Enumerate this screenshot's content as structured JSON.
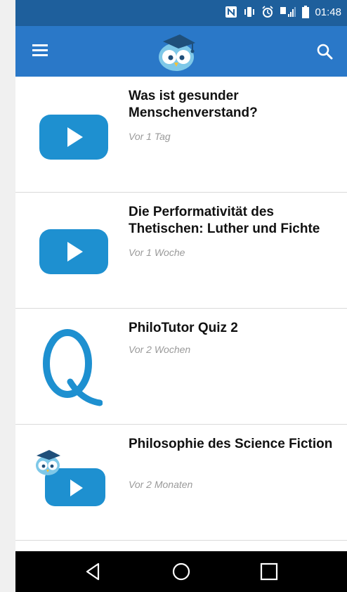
{
  "status_bar": {
    "time": "01:48",
    "icons": [
      "nfc-icon",
      "vibrate-icon",
      "alarm-icon",
      "signal-icon",
      "battery-icon"
    ]
  },
  "app_bar": {
    "menu_icon": "hamburger-menu-icon",
    "logo": "owl-logo",
    "search_icon": "search-icon",
    "color": "#2a78c8"
  },
  "feed": {
    "items": [
      {
        "title": "Was ist gesunder Menschenverstand?",
        "meta": "Vor 1 Tag",
        "thumb": "video-play-icon"
      },
      {
        "title": "Die Performativität des Thetischen: Luther und Fichte",
        "meta": "Vor 1 Woche",
        "thumb": "video-play-icon"
      },
      {
        "title": "PhiloTutor Quiz 2",
        "meta": "Vor 2 Wochen",
        "thumb": "quiz-q-icon"
      },
      {
        "title": "Philosophie des Science Fiction",
        "meta": "Vor 2 Monaten",
        "thumb": "owl-video-icon"
      }
    ]
  },
  "nav_bar": {
    "buttons": [
      "back-icon",
      "home-icon",
      "recents-icon"
    ]
  },
  "accent_color": "#1e90d0"
}
